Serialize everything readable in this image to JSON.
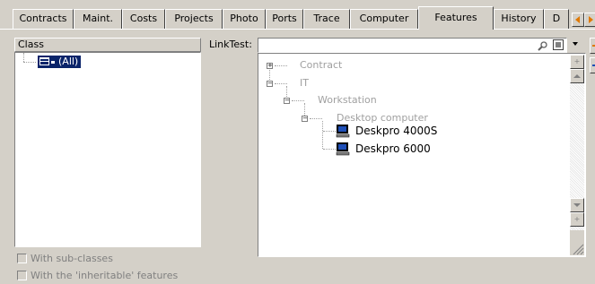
{
  "tabs": [
    {
      "label": "Contracts"
    },
    {
      "label": "Maint."
    },
    {
      "label": "Costs"
    },
    {
      "label": "Projects"
    },
    {
      "label": "Photo"
    },
    {
      "label": "Ports"
    },
    {
      "label": "Trace"
    },
    {
      "label": "Computer"
    },
    {
      "label": "Features"
    },
    {
      "label": "History"
    },
    {
      "label": "D"
    }
  ],
  "class_panel": {
    "header": "Class",
    "root_item": "(All)"
  },
  "checkboxes": {
    "sub_classes": "With sub-classes",
    "inheritable": "With the 'inheritable' features"
  },
  "linktest": {
    "label": "LinkTest:",
    "value": ""
  },
  "tree": {
    "nodes": [
      {
        "label": "Contract"
      },
      {
        "label": "IT"
      },
      {
        "label": "Workstation"
      },
      {
        "label": "Desktop computer"
      },
      {
        "label": "Deskpro 4000S"
      },
      {
        "label": "Deskpro 6000"
      }
    ]
  },
  "colors": {
    "selection": "#0a246a",
    "accent_orange": "#e07800",
    "face": "#d4d0c8"
  }
}
